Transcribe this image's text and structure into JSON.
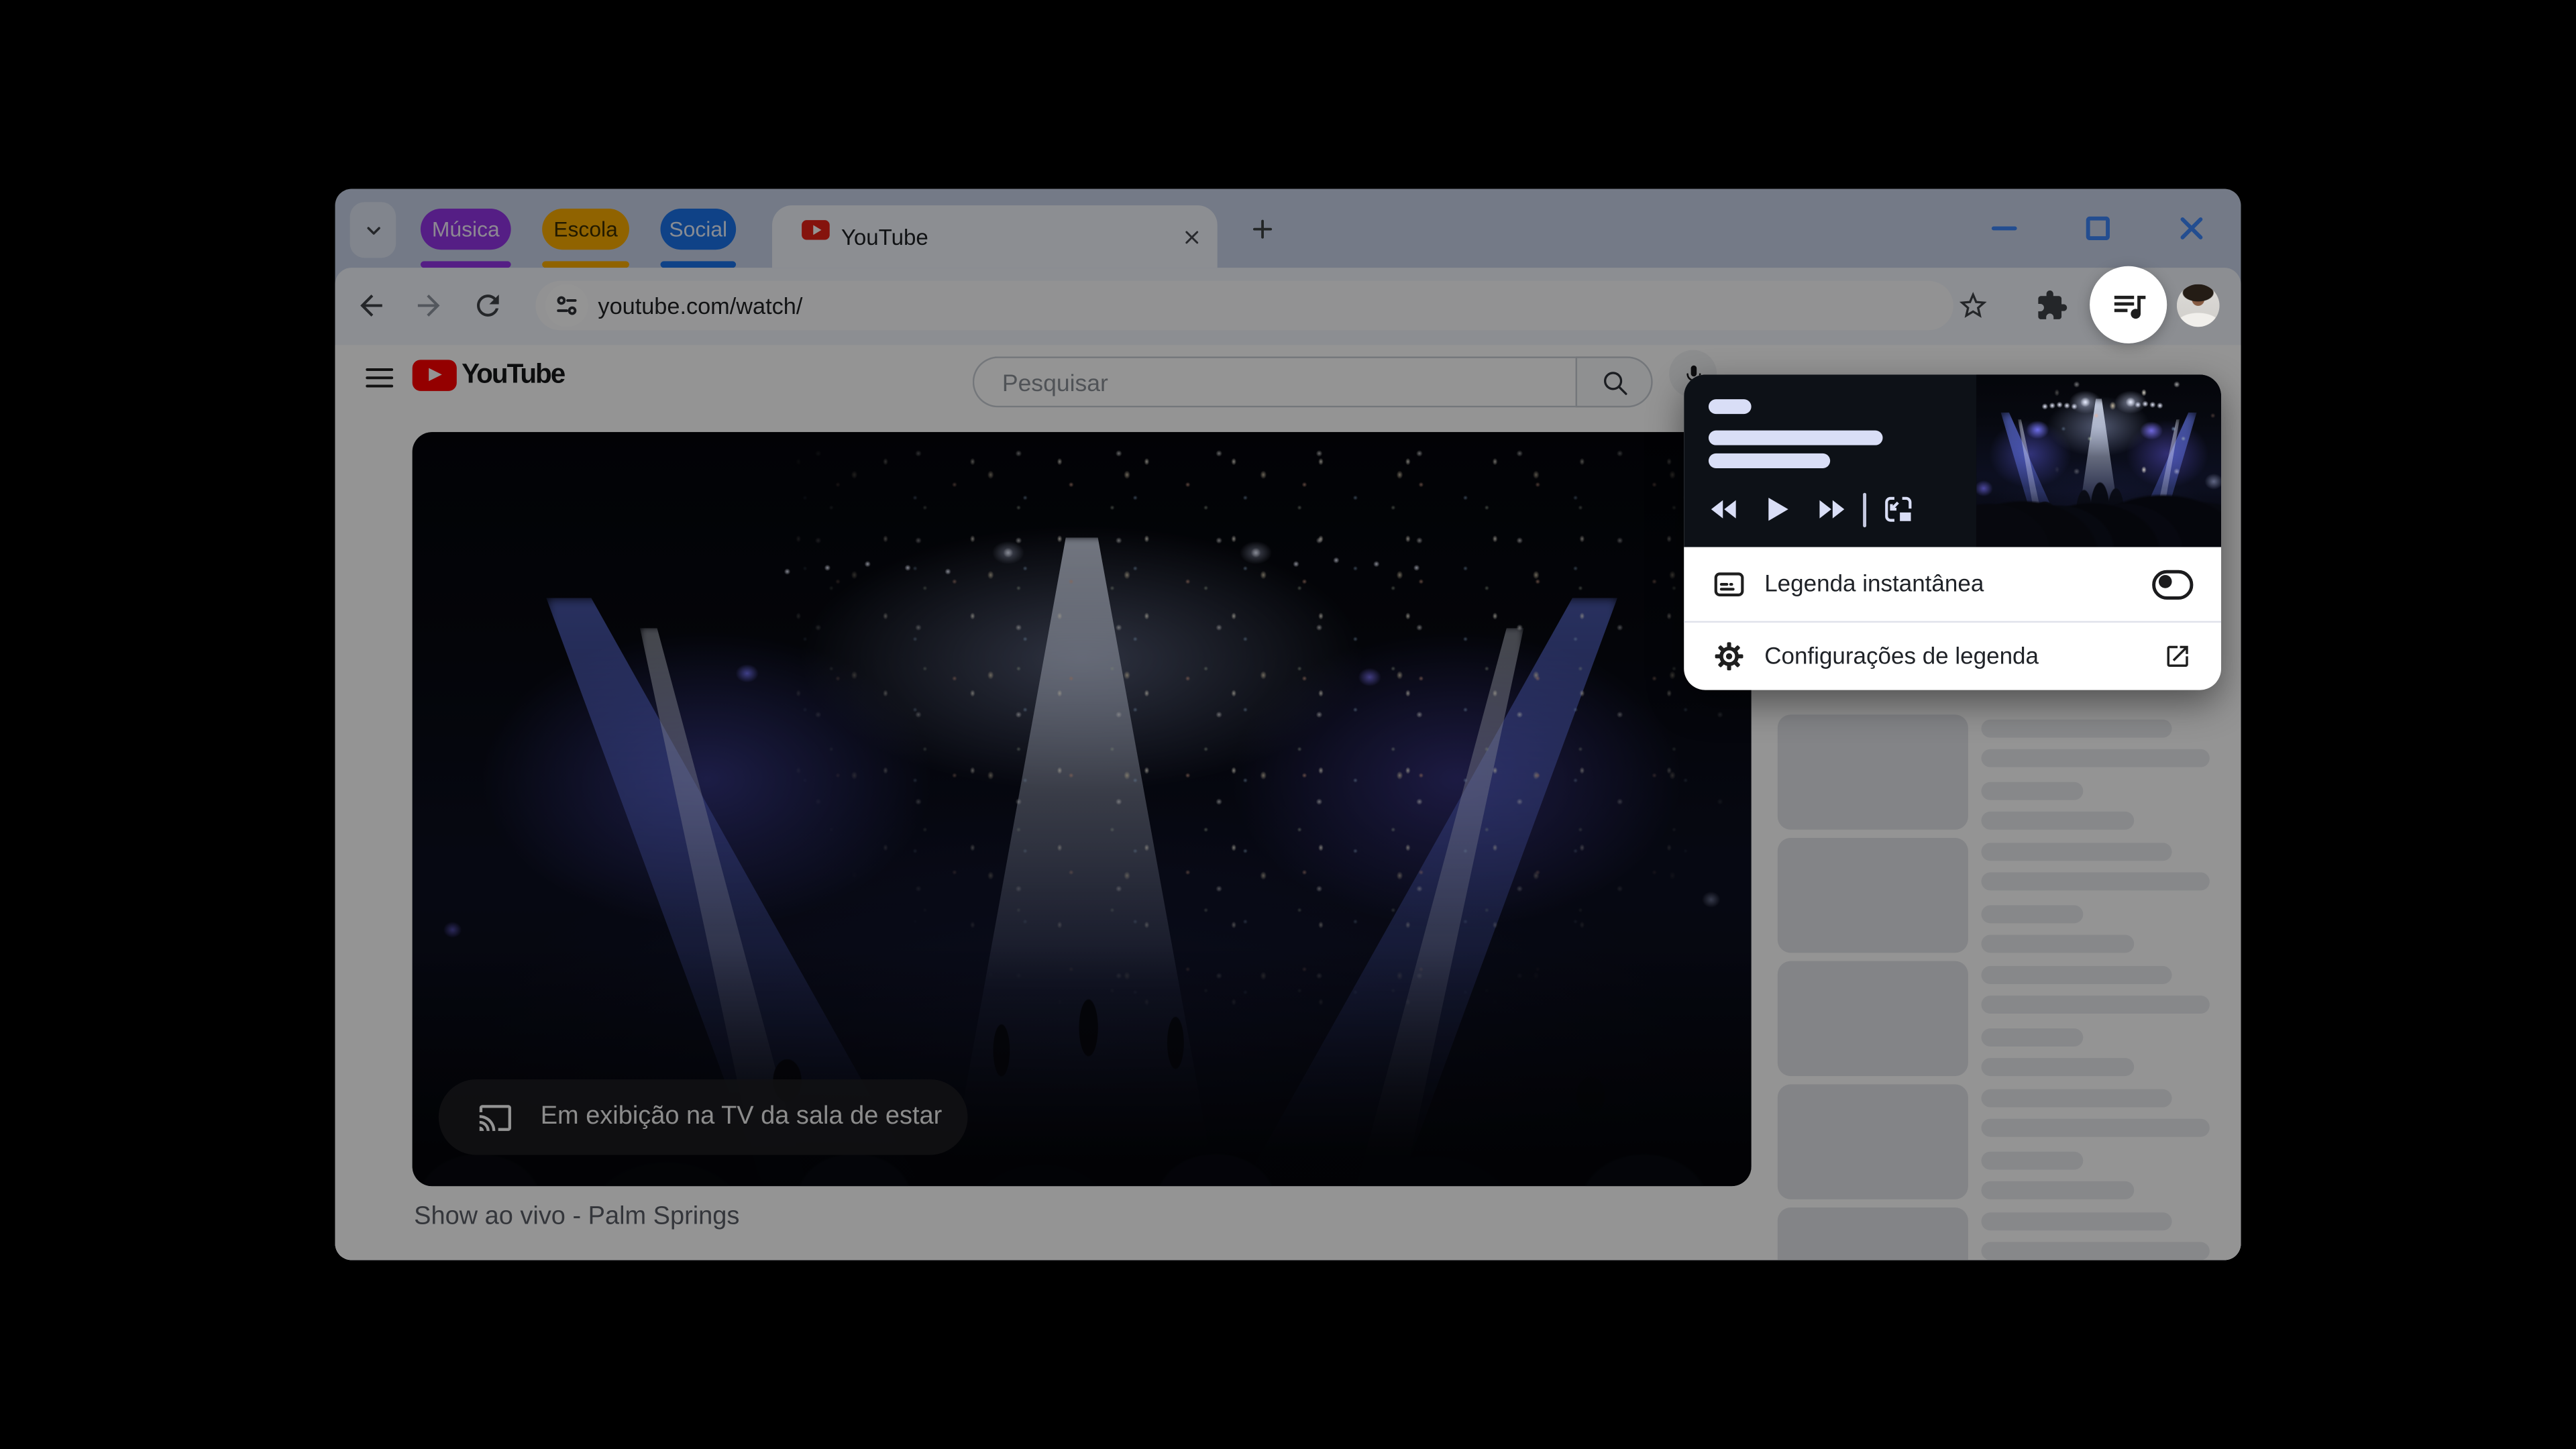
{
  "tabstrip": {
    "groups": [
      {
        "label": "Música",
        "color": "#9334e6",
        "text_color": "#f3eafb"
      },
      {
        "label": "Escola",
        "color": "#f9ab00",
        "text_color": "#3c2e00"
      },
      {
        "label": "Social",
        "color": "#1a73e8",
        "text_color": "#e8f0fd"
      }
    ],
    "active_tab": {
      "title": "YouTube"
    }
  },
  "window_controls": {
    "accent_color": "#3d86f8"
  },
  "toolbar": {
    "url": "youtube.com/watch/"
  },
  "youtube": {
    "search_placeholder": "Pesquisar",
    "video_title": "Show ao vivo - Palm Springs",
    "cast_overlay_text": "Em exibição na TV da sala de estar",
    "sidebar_skeleton_items": 5
  },
  "media_popup": {
    "rows": [
      {
        "label": "Legenda instantânea",
        "control": "toggle",
        "state": "off"
      },
      {
        "label": "Configurações de legenda",
        "control": "open-in-new"
      }
    ]
  },
  "icons": {
    "media_button": "queue-music",
    "cast": "chromecast",
    "popup_row1": "closed-captions",
    "popup_row2": "settings-gear"
  },
  "colors": {
    "youtube_red": "#ff0000",
    "scrim": "rgba(0,0,0,0.42)",
    "popup_dark_bg": "#0d1117",
    "popup_skeleton": "#d9def6"
  }
}
